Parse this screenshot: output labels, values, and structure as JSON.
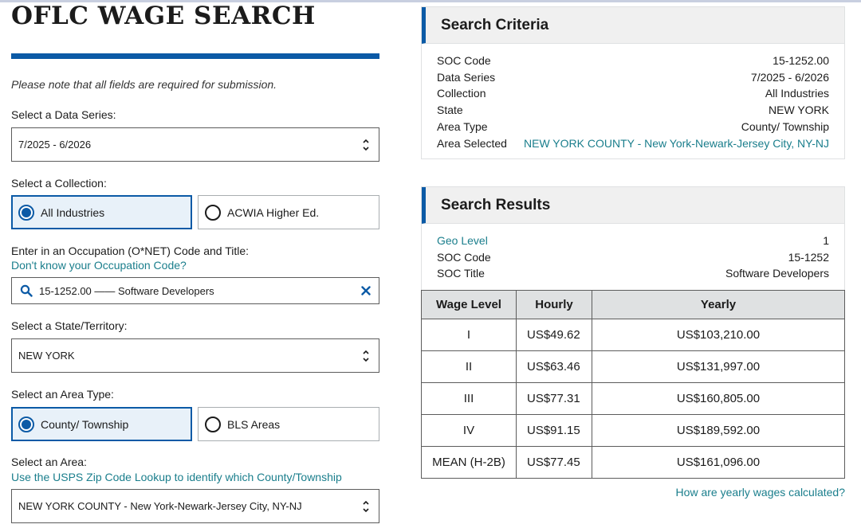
{
  "form": {
    "title": "OFLC WAGE SEARCH",
    "note": "Please note that all fields are required for submission.",
    "data_series": {
      "label": "Select a Data Series:",
      "value": "7/2025 - 6/2026"
    },
    "collection": {
      "label": "Select a Collection:",
      "options": [
        "All Industries",
        "ACWIA Higher Ed."
      ],
      "selected": "All Industries"
    },
    "occupation": {
      "label": "Enter in an Occupation (O*NET) Code and Title:",
      "help_link": "Don't know your Occupation Code?",
      "value": "15-1252.00 —— Software Developers"
    },
    "state": {
      "label": "Select a State/Territory:",
      "value": "NEW YORK"
    },
    "area_type": {
      "label": "Select an Area Type:",
      "options": [
        "County/ Township",
        "BLS Areas"
      ],
      "selected": "County/ Township"
    },
    "area": {
      "label": "Select an Area:",
      "help_link": "Use the USPS Zip Code Lookup to identify which County/Township",
      "value": "NEW YORK COUNTY - New York-Newark-Jersey City, NY-NJ"
    }
  },
  "criteria": {
    "heading": "Search Criteria",
    "rows": [
      {
        "key": "SOC Code",
        "value": "15-1252.00"
      },
      {
        "key": "Data Series",
        "value": "7/2025 - 6/2026"
      },
      {
        "key": "Collection",
        "value": "All Industries"
      },
      {
        "key": "State",
        "value": "NEW YORK"
      },
      {
        "key": "Area Type",
        "value": "County/ Township"
      },
      {
        "key": "Area Selected",
        "value": "NEW YORK COUNTY - New York-Newark-Jersey City, NY-NJ"
      }
    ]
  },
  "results": {
    "heading": "Search Results",
    "rows": [
      {
        "key": "Geo Level",
        "value": "1"
      },
      {
        "key": "SOC Code",
        "value": "15-1252"
      },
      {
        "key": "SOC Title",
        "value": "Software Developers"
      }
    ],
    "table": {
      "headers": [
        "Wage Level",
        "Hourly",
        "Yearly"
      ],
      "rows": [
        [
          "I",
          "US$49.62",
          "US$103,210.00"
        ],
        [
          "II",
          "US$63.46",
          "US$131,997.00"
        ],
        [
          "III",
          "US$77.31",
          "US$160,805.00"
        ],
        [
          "IV",
          "US$91.15",
          "US$189,592.00"
        ],
        [
          "MEAN (H-2B)",
          "US$77.45",
          "US$161,096.00"
        ]
      ]
    },
    "calc_link": "How are yearly wages calculated?"
  },
  "icons": {
    "search": "search-icon",
    "clear": "close-icon",
    "select_arrows": "chevron-up-down-icon",
    "radio": "radio-icon"
  },
  "colors": {
    "primary_blue": "#0b5aa6",
    "link_teal": "#1a7e8c",
    "selected_bg": "#e8f1f9",
    "panel_header_bg": "#f0f0f0"
  }
}
